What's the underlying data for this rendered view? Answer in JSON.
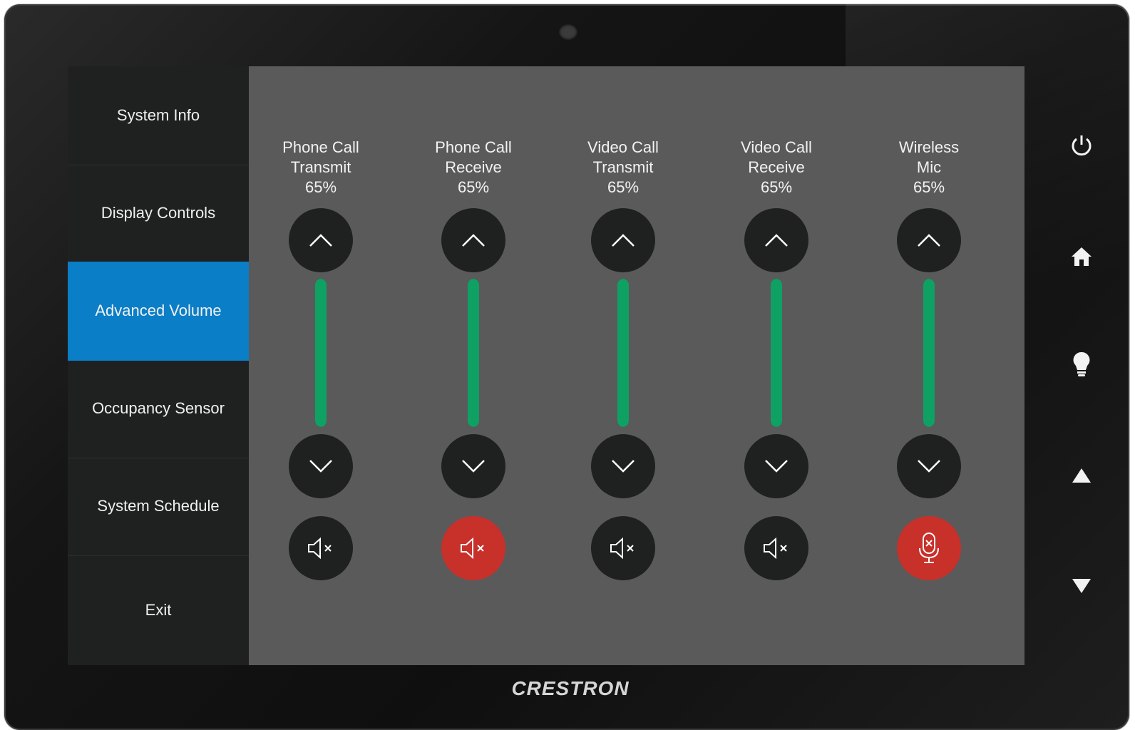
{
  "sidebar": {
    "items": [
      {
        "label": "System Info",
        "active": false
      },
      {
        "label": "Display Controls",
        "active": false
      },
      {
        "label": "Advanced Volume",
        "active": true
      },
      {
        "label": "Occupancy Sensor",
        "active": false
      },
      {
        "label": "System Schedule",
        "active": false
      },
      {
        "label": "Exit",
        "active": false
      }
    ]
  },
  "channels": [
    {
      "line1": "Phone Call",
      "line2": "Transmit",
      "level": "65%",
      "mute_icon": "speaker-mute-icon",
      "muted": false
    },
    {
      "line1": "Phone Call",
      "line2": "Receive",
      "level": "65%",
      "mute_icon": "speaker-mute-icon",
      "muted": true
    },
    {
      "line1": "Video Call",
      "line2": "Transmit",
      "level": "65%",
      "mute_icon": "speaker-mute-icon",
      "muted": false
    },
    {
      "line1": "Video Call",
      "line2": "Receive",
      "level": "65%",
      "mute_icon": "speaker-mute-icon",
      "muted": false
    },
    {
      "line1": "Wireless",
      "line2": "Mic",
      "level": "65%",
      "mute_icon": "mic-mute-icon",
      "muted": true
    }
  ],
  "hardware_buttons": [
    "power-icon",
    "home-icon",
    "lightbulb-icon",
    "arrow-up-icon",
    "arrow-down-icon"
  ],
  "brand": "CRESTRON",
  "colors": {
    "accent": "#0a7ec7",
    "level_fill": "#0fa064",
    "muted": "#c8302a",
    "button": "#1f2121",
    "panel": "#5a5a5a"
  }
}
